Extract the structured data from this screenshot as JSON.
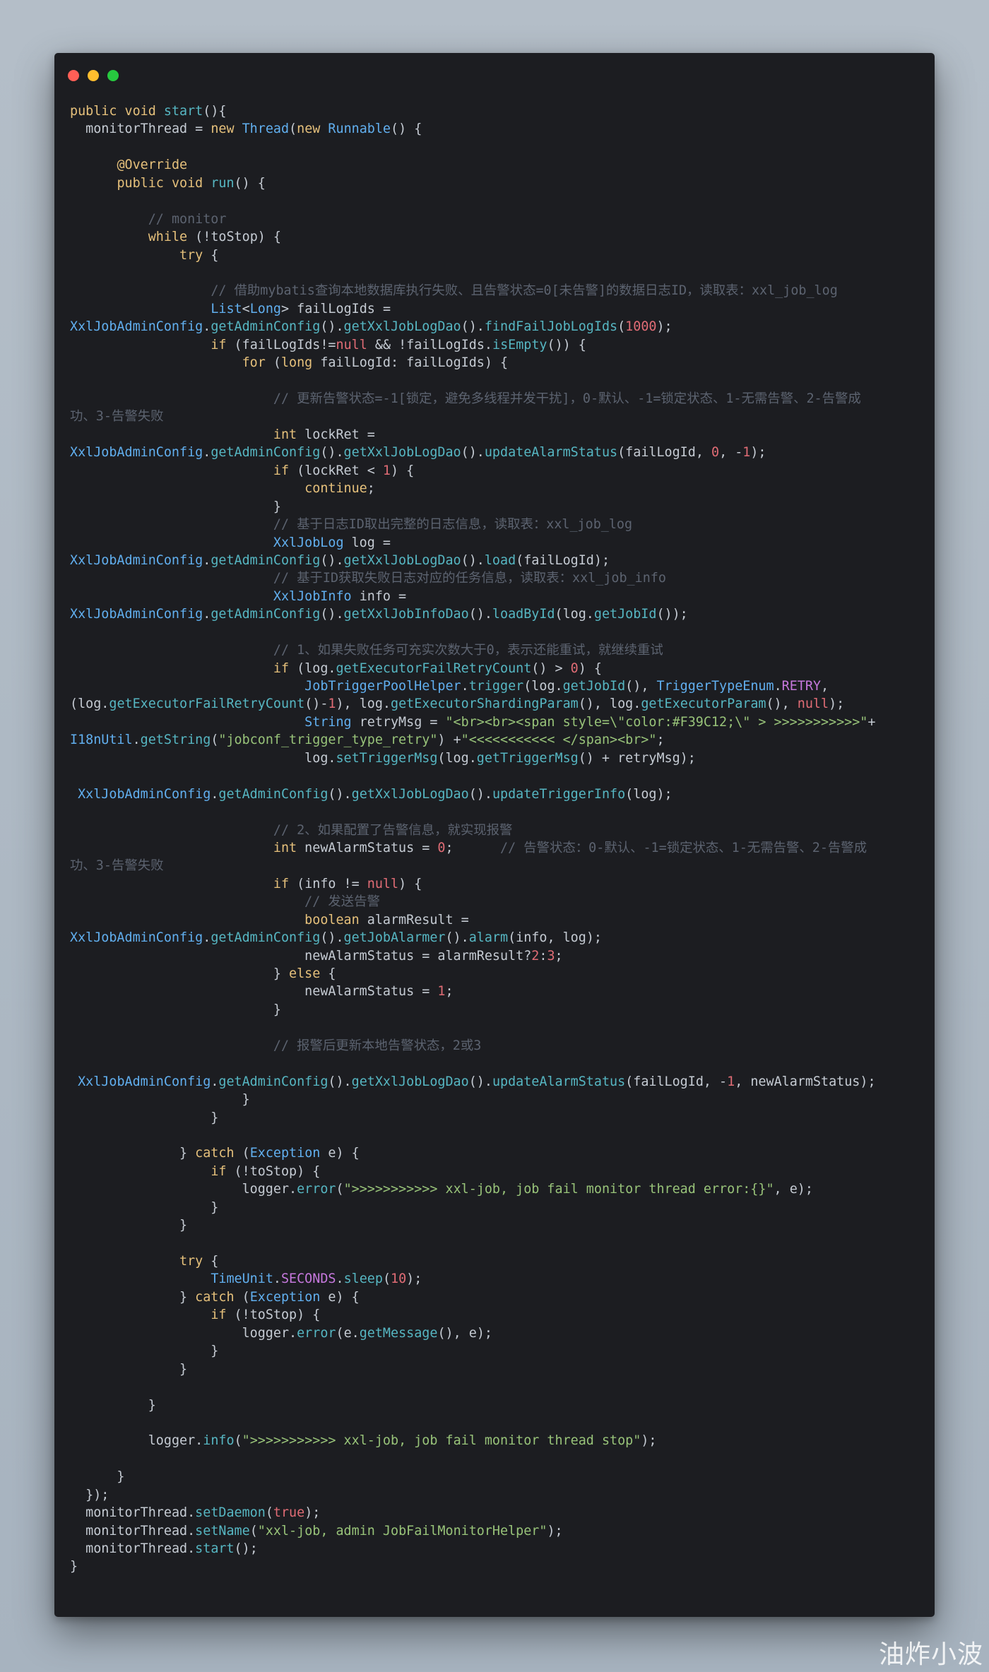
{
  "window": {
    "controls": [
      "close",
      "minimize",
      "maximize"
    ]
  },
  "code": {
    "lines": [
      "public void start(){",
      "  monitorThread = new Thread(new Runnable() {",
      "",
      "      @Override",
      "      public void run() {",
      "",
      "          // monitor",
      "          while (!toStop) {",
      "              try {",
      "",
      "                  // 借助mybatis查询本地数据库执行失败、且告警状态=0[未告警]的数据日志ID，读取表：xxl_job_log",
      "                  List<Long> failLogIds =",
      "XxlJobAdminConfig.getAdminConfig().getXxlJobLogDao().findFailJobLogIds(1000);",
      "                  if (failLogIds!=null && !failLogIds.isEmpty()) {",
      "                      for (long failLogId: failLogIds) {",
      "",
      "                          // 更新告警状态=-1[锁定，避免多线程并发干扰]，0-默认、-1=锁定状态、1-无需告警、2-告警成",
      "功、3-告警失败",
      "                          int lockRet =",
      "XxlJobAdminConfig.getAdminConfig().getXxlJobLogDao().updateAlarmStatus(failLogId, 0, -1);",
      "                          if (lockRet < 1) {",
      "                              continue;",
      "                          }",
      "                          // 基于日志ID取出完整的日志信息，读取表：xxl_job_log",
      "                          XxlJobLog log =",
      "XxlJobAdminConfig.getAdminConfig().getXxlJobLogDao().load(failLogId);",
      "                          // 基于ID获取失败日志对应的任务信息，读取表：xxl_job_info",
      "                          XxlJobInfo info =",
      "XxlJobAdminConfig.getAdminConfig().getXxlJobInfoDao().loadById(log.getJobId());",
      "",
      "                          // 1、如果失败任务可充实次数大于0，表示还能重试，就继续重试",
      "                          if (log.getExecutorFailRetryCount() > 0) {",
      "                              JobTriggerPoolHelper.trigger(log.getJobId(), TriggerTypeEnum.RETRY,",
      "(log.getExecutorFailRetryCount()-1), log.getExecutorShardingParam(), log.getExecutorParam(), null);",
      "                              String retryMsg = \"<br><br><span style=\\\"color:#F39C12;\\\" > >>>>>>>>>>>\"+",
      "I18nUtil.getString(\"jobconf_trigger_type_retry\") +\"<<<<<<<<<<< </span><br>\";",
      "                              log.setTriggerMsg(log.getTriggerMsg() + retryMsg);",
      "",
      " XxlJobAdminConfig.getAdminConfig().getXxlJobLogDao().updateTriggerInfo(log);",
      "",
      "                          // 2、如果配置了告警信息，就实现报警",
      "                          int newAlarmStatus = 0;      // 告警状态：0-默认、-1=锁定状态、1-无需告警、2-告警成",
      "功、3-告警失败",
      "                          if (info != null) {",
      "                              // 发送告警",
      "                              boolean alarmResult =",
      "XxlJobAdminConfig.getAdminConfig().getJobAlarmer().alarm(info, log);",
      "                              newAlarmStatus = alarmResult?2:3;",
      "                          } else {",
      "                              newAlarmStatus = 1;",
      "                          }",
      "",
      "                          // 报警后更新本地告警状态，2或3",
      "",
      " XxlJobAdminConfig.getAdminConfig().getXxlJobLogDao().updateAlarmStatus(failLogId, -1, newAlarmStatus);",
      "                      }",
      "                  }",
      "",
      "              } catch (Exception e) {",
      "                  if (!toStop) {",
      "                      logger.error(\">>>>>>>>>>> xxl-job, job fail monitor thread error:{}\", e);",
      "                  }",
      "              }",
      "",
      "              try {",
      "                  TimeUnit.SECONDS.sleep(10);",
      "              } catch (Exception e) {",
      "                  if (!toStop) {",
      "                      logger.error(e.getMessage(), e);",
      "                  }",
      "              }",
      "",
      "          }",
      "",
      "          logger.info(\">>>>>>>>>>> xxl-job, job fail monitor thread stop\");",
      "",
      "      }",
      "  });",
      "  monitorThread.setDaemon(true);",
      "  monitorThread.setName(\"xxl-job, admin JobFailMonitorHelper\");",
      "  monitorThread.start();",
      "}"
    ]
  },
  "watermark": "油炸小波",
  "colors": {
    "window_bg": "#1c1d21",
    "page_bg": "#b0bac5",
    "keyword": "#e5c07b",
    "type": "#61afef",
    "string": "#98c379",
    "number": "#e06c75",
    "comment": "#5c6370",
    "text": "#c5cbd3"
  }
}
